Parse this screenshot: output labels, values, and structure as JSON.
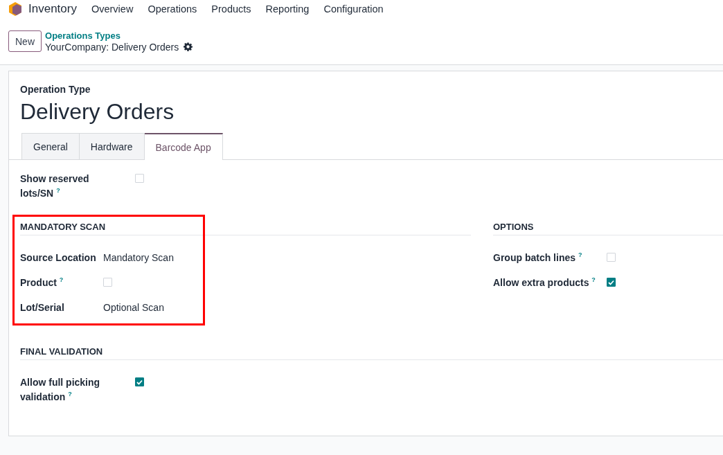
{
  "navbar": {
    "app_name": "Inventory",
    "menu": [
      "Overview",
      "Operations",
      "Products",
      "Reporting",
      "Configuration"
    ]
  },
  "control_panel": {
    "new_button": "New",
    "breadcrumb": "Operations Types",
    "record": "YourCompany: Delivery Orders"
  },
  "form": {
    "subtitle": "Operation Type",
    "title": "Delivery Orders",
    "tabs": [
      {
        "label": "General",
        "selected": false
      },
      {
        "label": "Hardware",
        "selected": false
      },
      {
        "label": "Barcode App",
        "selected": true
      }
    ],
    "top_fields": [
      {
        "kind": "checkbox",
        "label": "Show reserved lots/SN",
        "help": "?",
        "checked": false
      }
    ],
    "sections": [
      {
        "title": "MANDATORY SCAN",
        "highlighted": true,
        "fields": [
          {
            "kind": "value",
            "label": "Source Location",
            "value": "Mandatory Scan"
          },
          {
            "kind": "checkbox",
            "label": "Product",
            "help": "?",
            "checked": false
          },
          {
            "kind": "value",
            "label": "Lot/Serial",
            "value": "Optional Scan"
          }
        ]
      },
      {
        "title": "OPTIONS",
        "highlighted": false,
        "fields": [
          {
            "kind": "checkbox",
            "label": "Group batch lines",
            "help": "?",
            "checked": false
          },
          {
            "kind": "checkbox",
            "label": "Allow extra products",
            "help": "?",
            "checked": true
          }
        ]
      },
      {
        "title": "FINAL VALIDATION",
        "highlighted": false,
        "fields": [
          {
            "kind": "checkbox",
            "label": "Allow full picking validation",
            "help": "?",
            "checked": true
          }
        ]
      }
    ]
  }
}
